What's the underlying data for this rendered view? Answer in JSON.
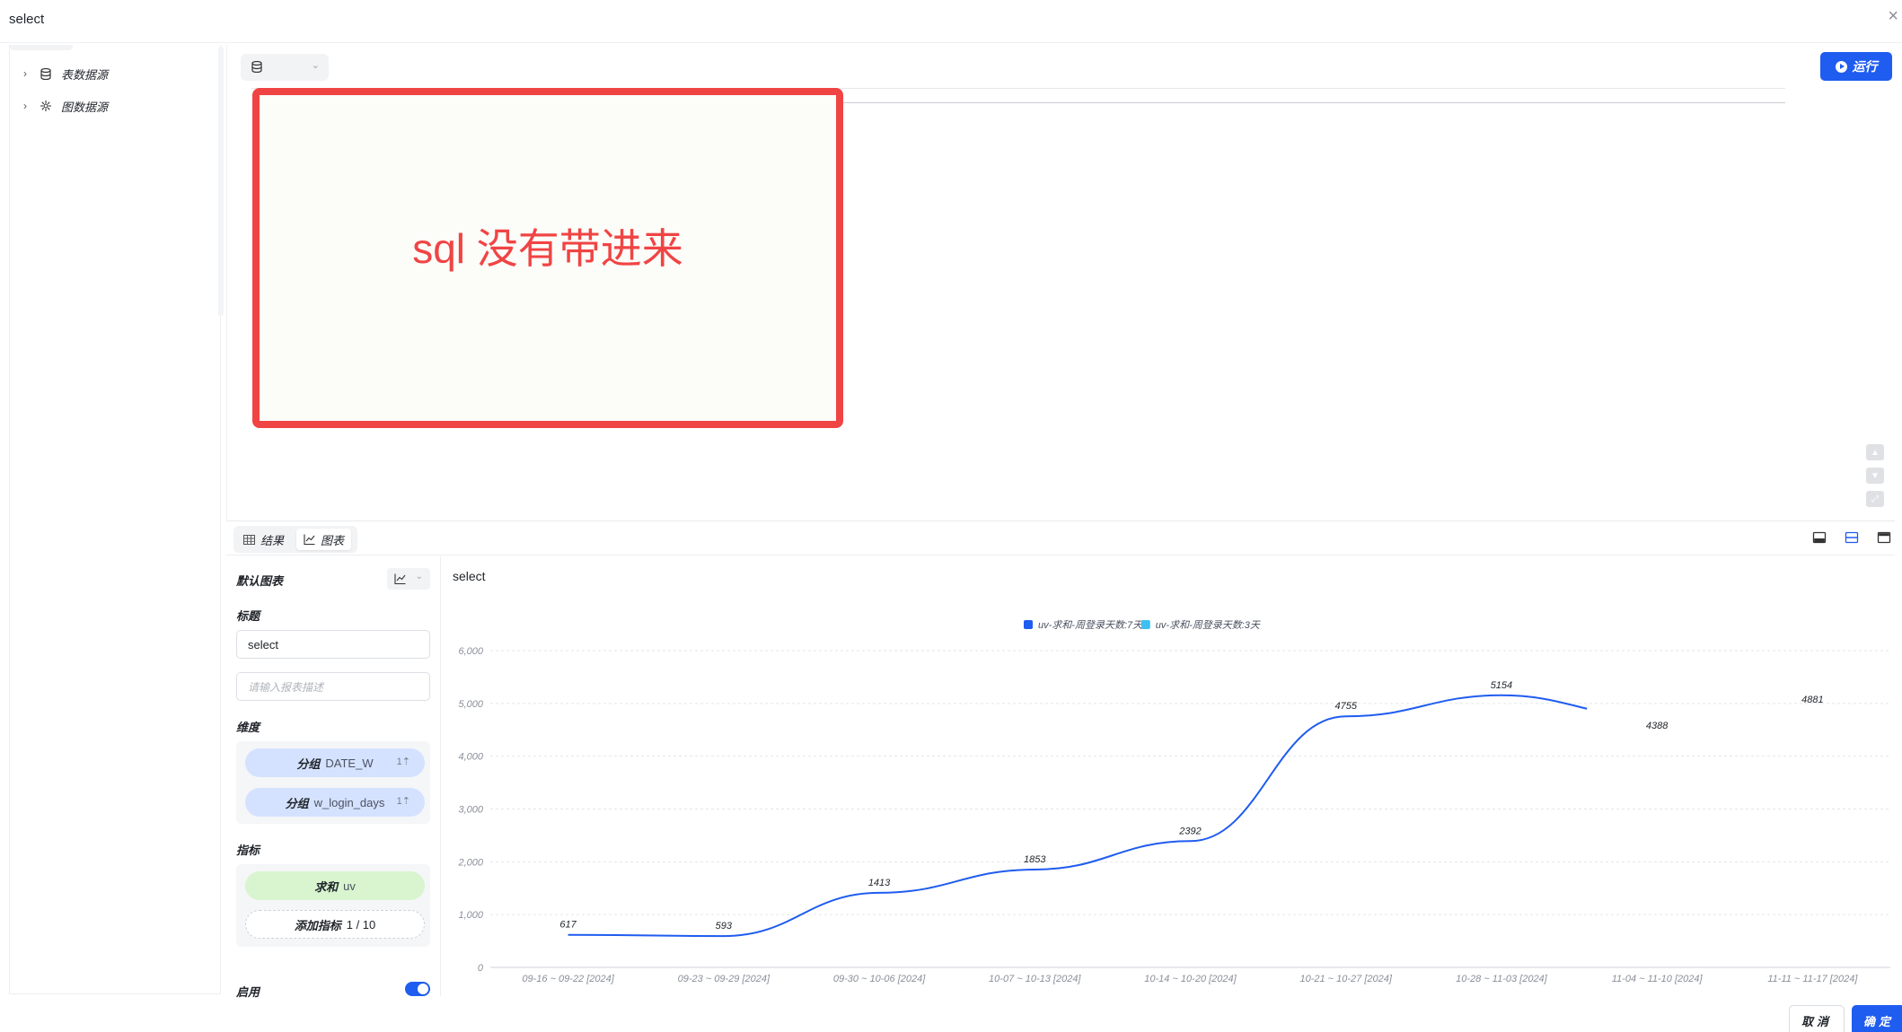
{
  "window": {
    "title": "select",
    "close_glyph": "×"
  },
  "sidebar": {
    "items": [
      {
        "label": "表数据源",
        "icon": "database-icon",
        "chevron": "›"
      },
      {
        "label": "图数据源",
        "icon": "graph-icon",
        "chevron": "›"
      }
    ]
  },
  "editor": {
    "run_label": "运行",
    "annotation": "sql 没有带进来",
    "annotation_color": "#f04444",
    "accent": "#1f5cf0"
  },
  "result_tabs": [
    {
      "label": "结果",
      "icon": "table-icon",
      "active": false
    },
    {
      "label": "图表",
      "icon": "line-chart-icon",
      "active": true
    }
  ],
  "config": {
    "default_chart_label": "默认图表",
    "title_label": "标题",
    "title_value": "select",
    "description_placeholder": "请输入报表描述",
    "dimension_label": "维度",
    "dimensions": [
      {
        "prefix": "分组",
        "field": "DATE_W"
      },
      {
        "prefix": "分组",
        "field": "w_login_days"
      }
    ],
    "metric_label": "指标",
    "metrics": [
      {
        "prefix": "求和",
        "field": "uv"
      }
    ],
    "add_metric": {
      "label": "添加指标",
      "count": "1 / 10"
    },
    "enable_label": "启用",
    "enabled": true
  },
  "chart_title": "select",
  "chart_data": {
    "type": "line",
    "categories": [
      "09-16 ~ 09-22 [2024]",
      "09-23 ~ 09-29 [2024]",
      "09-30 ~ 10-06 [2024]",
      "10-07 ~ 10-13 [2024]",
      "10-14 ~ 10-20 [2024]",
      "10-21 ~ 10-27 [2024]",
      "10-28 ~ 11-03 [2024]",
      "11-04 ~ 11-10 [2024]",
      "11-11 ~ 11-17 [2024]"
    ],
    "series": [
      {
        "name": "uv-求和-周登录天数:7天",
        "color": "#1f5cf0",
        "values": [
          617,
          593,
          1413,
          1853,
          2392,
          4755,
          5154,
          4388,
          4881
        ]
      },
      {
        "name": "uv-求和-周登录天数:3天",
        "color": "#3ec0f0",
        "values": []
      }
    ],
    "y_ticks": [
      "6,000",
      "5,000",
      "4,000",
      "3,000",
      "2,000",
      "1,000",
      "0"
    ],
    "ylim": [
      0,
      6000
    ],
    "legend": "top-center",
    "grid": true
  },
  "footer": {
    "cancel_label": "取消",
    "ok_label": "确定"
  }
}
